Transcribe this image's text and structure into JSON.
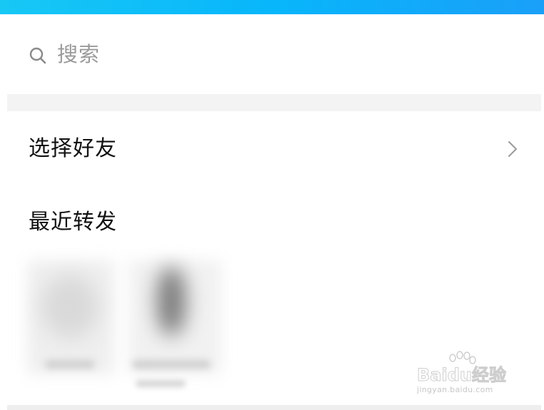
{
  "search": {
    "placeholder": "搜索",
    "icon": "search-icon"
  },
  "select_friends": {
    "label": "选择好友",
    "icon": "chevron-right-icon"
  },
  "recent": {
    "title": "最近转发",
    "contacts": [
      {
        "name": "",
        "avatar": "blurred"
      },
      {
        "name": "",
        "avatar": "blurred"
      }
    ]
  },
  "watermark": {
    "brand": "Baidu经验",
    "url": "jingyan.baidu.com"
  },
  "colors": {
    "top_bar_start": "#17c8f5",
    "top_bar_end": "#1a9ff8",
    "divider": "#f3f3f3",
    "primary_text": "#111111",
    "placeholder_text": "#9a9a9a"
  }
}
